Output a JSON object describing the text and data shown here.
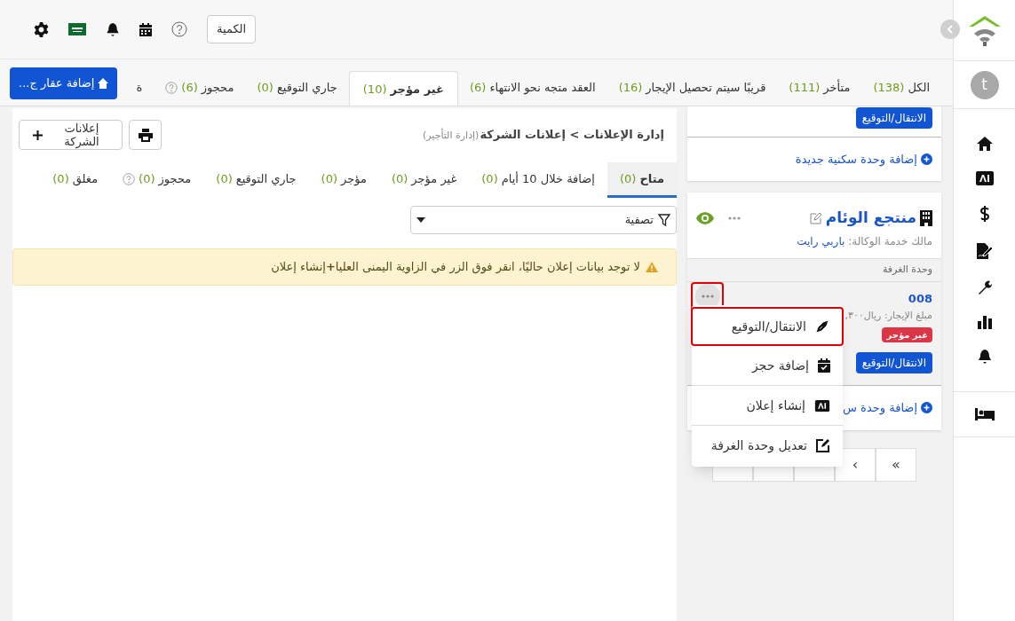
{
  "header": {
    "quantity_button": "الكمية"
  },
  "sidebar": {
    "avatar": "t"
  },
  "property_tabs": [
    {
      "label": "الكل",
      "count": "(138)",
      "selected": false
    },
    {
      "label": "متأخر",
      "count": "(111)",
      "selected": false
    },
    {
      "label": "قريبًا سيتم تحصيل الإيجار",
      "count": "(16)",
      "selected": false
    },
    {
      "label": "العقد متجه نحو الانتهاء",
      "count": "(6)",
      "selected": false
    },
    {
      "label": "غير مؤجر",
      "count": "(10)",
      "selected": true
    },
    {
      "label": "جاري التوقيع",
      "count": "(0)",
      "selected": false
    },
    {
      "label": "محجوز",
      "count": "(6)",
      "selected": false,
      "help": true
    },
    {
      "label": "ة",
      "selected": false
    }
  ],
  "add_property_button": "إضافة عقار ج...",
  "breadcrumb": {
    "path": "إدارة الإعلانات > إعلانات الشركة",
    "context": "(إدارة التأجير)"
  },
  "company_ads_button": "إعلانات الشركة",
  "ad_tabs": [
    {
      "label": "متاح",
      "count": "(0)",
      "selected": true
    },
    {
      "label": "إضافة خلال 10 أيام",
      "count": "(0)",
      "selected": false
    },
    {
      "label": "غير مؤجر",
      "count": "(0)",
      "selected": false
    },
    {
      "label": "مؤجر",
      "count": "(0)",
      "selected": false
    },
    {
      "label": "جاري التوقيع",
      "count": "(0)",
      "selected": false
    },
    {
      "label": "محجوز",
      "count": "(0)",
      "selected": false,
      "help": true
    },
    {
      "label": "مغلق",
      "count": "(0)",
      "selected": false
    }
  ],
  "filter": {
    "label": "تصفية"
  },
  "alert": "لا توجد بيانات إعلان حاليًا، انقر فوق الزر في الزاوية اليمنى العليا**+**إنشاء إعلان",
  "top_card": {
    "move_button": "الانتقال/التوقيع",
    "add_unit_link": "إضافة وحدة سكنية جديدة"
  },
  "property_card": {
    "name": "منتجع الوئام",
    "owner_label": "مالك خدمة الوكالة:",
    "owner_name": "باربي رايت",
    "section": "وحدة الغرفة",
    "unit": {
      "number": "008",
      "rent": "مبلغ الإيجار: ريال٣٠٠,",
      "status": "غير مؤجر",
      "move_button": "الانتقال/التوقيع",
      "more_highlighted": true
    },
    "add_unit_link": "إضافة وحدة س"
  },
  "pagination": [
    "»",
    "›"
  ],
  "menu": [
    {
      "label": "الانتقال/التوقيع",
      "highlighted": true
    },
    {
      "label": "إضافة حجز",
      "highlighted": false
    },
    {
      "label": "إنشاء إعلان",
      "highlighted": false
    },
    {
      "label": "تعديل وحدة الغرفة",
      "highlighted": false
    }
  ]
}
